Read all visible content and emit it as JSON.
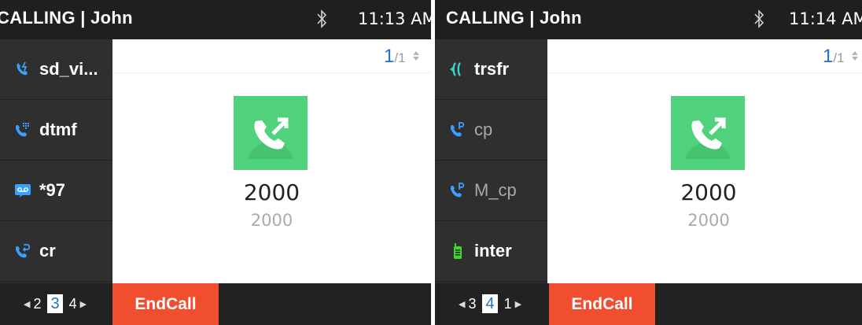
{
  "colors": {
    "accent_blue": "#1e73c8",
    "call_green": "#50d27c",
    "endcall_red": "#f04e2e",
    "intercom_green": "#3fd62e"
  },
  "left": {
    "status": {
      "title": "CALLING | John",
      "time": "11:13 AM",
      "bluetooth_icon": "bluetooth-icon"
    },
    "sidebar": [
      {
        "label": "sd_vi...",
        "icon": "speed-dial-call-icon",
        "dim": false
      },
      {
        "label": "dtmf",
        "icon": "dtmf-keypad-call-icon",
        "dim": false
      },
      {
        "label": "*97",
        "icon": "voicemail-icon",
        "dim": false
      },
      {
        "label": "cr",
        "icon": "call-return-icon",
        "dim": false
      }
    ],
    "page_indicator": {
      "current": "1",
      "total": "/1"
    },
    "contact": {
      "name": "2000",
      "number": "2000",
      "icon": "outgoing-call-icon"
    },
    "pager": {
      "prev": "2",
      "current": "3",
      "next": "4"
    },
    "softkey": "EndCall"
  },
  "right": {
    "status": {
      "title": "CALLING | John",
      "time": "11:14 AM",
      "bluetooth_icon": "bluetooth-icon"
    },
    "sidebar": [
      {
        "label": "trsfr",
        "icon": "transfer-icon",
        "dim": false
      },
      {
        "label": "cp",
        "icon": "call-park-icon",
        "dim": true
      },
      {
        "label": "M_cp",
        "icon": "monitored-call-park-icon",
        "dim": true
      },
      {
        "label": "inter",
        "icon": "intercom-icon",
        "dim": false
      }
    ],
    "page_indicator": {
      "current": "1",
      "total": "/1"
    },
    "contact": {
      "name": "2000",
      "number": "2000",
      "icon": "outgoing-call-icon"
    },
    "pager": {
      "prev": "3",
      "current": "4",
      "next": "1"
    },
    "softkey": "EndCall"
  }
}
